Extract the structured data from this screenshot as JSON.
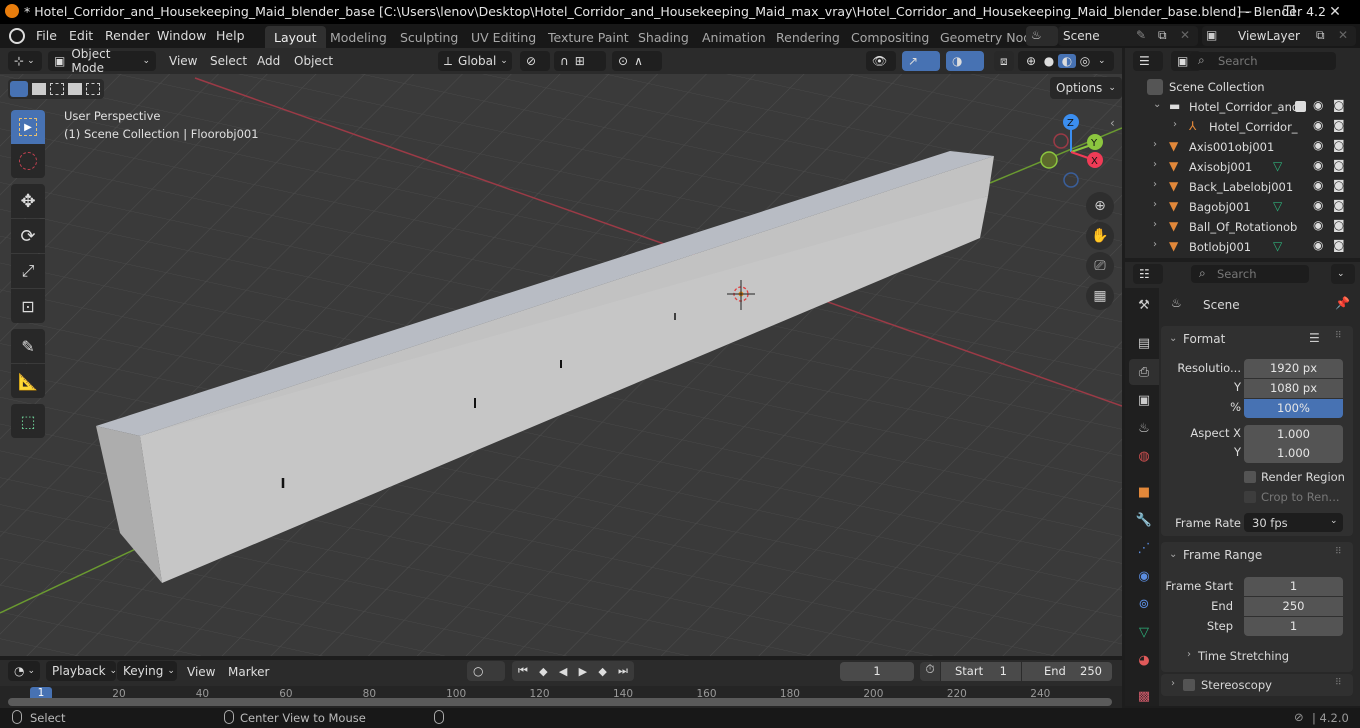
{
  "title_bar": {
    "title": "* Hotel_Corridor_and_Housekeeping_Maid_blender_base [C:\\Users\\lenov\\Desktop\\Hotel_Corridor_and_Housekeeping_Maid_max_vray\\Hotel_Corridor_and_Housekeeping_Maid_blender_base.blend] - Blender 4.2",
    "minimize": "—",
    "maximize": "❐",
    "close": "✕"
  },
  "menu": [
    "File",
    "Edit",
    "Render",
    "Window",
    "Help"
  ],
  "workspaces": [
    "Layout",
    "Modeling",
    "Sculpting",
    "UV Editing",
    "Texture Paint",
    "Shading",
    "Animation",
    "Rendering",
    "Compositing",
    "Geometry Nod"
  ],
  "active_workspace": "Layout",
  "scene_selector": {
    "value": "Scene"
  },
  "viewlayer_selector": {
    "value": "ViewLayer"
  },
  "viewport_header": {
    "mode": "Object Mode",
    "menus": [
      "View",
      "Select",
      "Add",
      "Object"
    ],
    "transform_orientation": "Global",
    "options": "Options"
  },
  "viewport": {
    "perspective_label": "User Perspective",
    "context_label": "(1) Scene Collection | Floorobj001",
    "gizmo_axes": [
      "X",
      "Y",
      "Z"
    ]
  },
  "toolbar_tools": [
    "select-box",
    "cursor",
    "move",
    "rotate",
    "scale",
    "transform",
    "annotate",
    "measure",
    "add-cube"
  ],
  "outliner": {
    "search_placeholder": "Search",
    "root": "Scene Collection",
    "items": [
      {
        "name": "Hotel_Corridor_and",
        "type": "collection",
        "expanded": true,
        "checked": true
      },
      {
        "name": "Hotel_Corridor_",
        "type": "empty",
        "indent": 1
      },
      {
        "name": "Axis001obj001",
        "type": "mesh"
      },
      {
        "name": "Axisobj001",
        "type": "mesh",
        "has_data_icon": true
      },
      {
        "name": "Back_Labelobj001",
        "type": "mesh"
      },
      {
        "name": "Bagobj001",
        "type": "mesh",
        "has_data_icon": true
      },
      {
        "name": "Ball_Of_Rotationob",
        "type": "mesh"
      },
      {
        "name": "Botlobj001",
        "type": "mesh",
        "has_data_icon": true
      }
    ]
  },
  "properties": {
    "search_placeholder": "Search",
    "context": "Scene",
    "format": {
      "title": "Format",
      "resolution_x_label": "Resolutio...",
      "resolution_x": "1920 px",
      "resolution_y_label": "Y",
      "resolution_y": "1080 px",
      "percent_label": "%",
      "percent": "100%",
      "aspect_x_label": "Aspect X",
      "aspect_x": "1.000",
      "aspect_y_label": "Y",
      "aspect_y": "1.000",
      "render_region": "Render Region",
      "crop": "Crop to Ren...",
      "frame_rate_label": "Frame Rate",
      "frame_rate": "30 fps"
    },
    "frame_range": {
      "title": "Frame Range",
      "start_label": "Frame Start",
      "start": "1",
      "end_label": "End",
      "end": "250",
      "step_label": "Step",
      "step": "1",
      "time_stretching": "Time Stretching"
    },
    "stereoscopy": "Stereoscopy"
  },
  "timeline": {
    "menus": [
      "Playback",
      "Keying",
      "View",
      "Marker"
    ],
    "current_frame": "1",
    "start_label": "Start",
    "start": "1",
    "end_label": "End",
    "end": "250",
    "ticks": [
      "20",
      "40",
      "60",
      "80",
      "100",
      "120",
      "140",
      "160",
      "180",
      "200",
      "220",
      "240"
    ],
    "playhead": "1"
  },
  "status_bar": {
    "select": "Select",
    "center_view": "Center View to Mouse",
    "version": "4.2.0"
  },
  "colors": {
    "accent": "#4772b3",
    "x_axis": "#f03b56",
    "y_axis": "#8cc63f",
    "z_axis": "#3b8ef0",
    "object_orange": "#e2883a",
    "mesh_data_green": "#2eb07a"
  }
}
